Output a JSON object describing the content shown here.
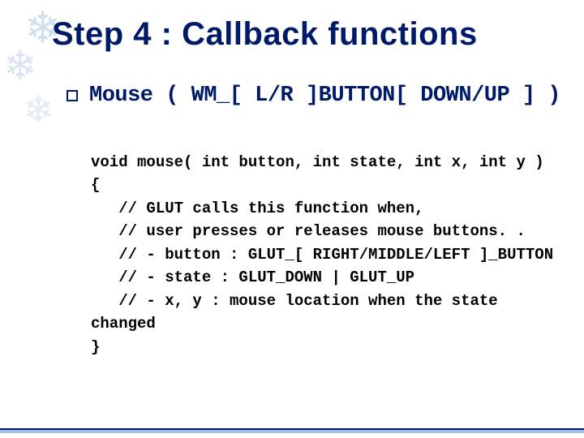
{
  "title": "Step 4 : Callback functions",
  "bullet": {
    "subheading": "Mouse ( WM_[ L/R ]BUTTON[ DOWN/UP ] )"
  },
  "code": {
    "l1": "void mouse( int button, int state, int x, int y )",
    "l2": "{",
    "l3": "   // GLUT calls this function when,",
    "l4": "   // user presses or releases mouse buttons. .",
    "l5": "   // - button : GLUT_[ RIGHT/MIDDLE/LEFT ]_BUTTON",
    "l6": "   // - state : GLUT_DOWN | GLUT_UP",
    "l7": "   // - x, y : mouse location when the state",
    "l8": "changed",
    "l9": "}"
  }
}
